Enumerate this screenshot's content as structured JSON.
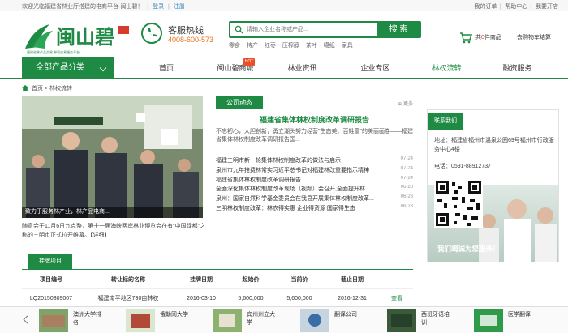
{
  "topbar": {
    "welcome": "欢迎光临福建省林业厅搭建的电商平台-闽山碧！",
    "login": "登录",
    "register": "注册",
    "links": [
      "我的订单",
      "帮助中心",
      "我要开店"
    ]
  },
  "header": {
    "logo_text": "闽山碧",
    "logo_sub": "福建省林产品交易 林权交易服务平台",
    "hotline_label": "客服热线",
    "hotline_number": "4008-600-573",
    "search_placeholder": "请输入企业名称或产品...",
    "search_button": "搜 索",
    "hotwords": [
      "零食",
      "特产",
      "红枣",
      "压榨醇",
      "茶叶",
      "噶纸",
      "家具"
    ],
    "cart_prefix": "共",
    "cart_count": "0",
    "cart_suffix": "件商品",
    "order_link": "去购物车结算"
  },
  "nav": {
    "category": "全部产品分类",
    "items": [
      "首页",
      "闽山碧商城",
      "林业资讯",
      "企业专区",
      "林权流转",
      "融资服务"
    ],
    "hot_badge": "HOT"
  },
  "breadcrumb": {
    "home": "首页",
    "current": "林权流转"
  },
  "photo": {
    "caption": "致力于服务林产业，林产品电商..."
  },
  "photo_text": "随意会于11月6日九点整，第十一届海峡两岸林业博览会在有\"中国绿都\"之称的三明市正式拉开帷幕。【详细】",
  "news": {
    "tab": "公司动态",
    "more": "更多",
    "headline": "福建省集体林权制度改革调研报告",
    "summary": "不忘初心，大胆创新，勇立潮头努力经营\"生态美、百姓富\"的美丽画卷——福建省集体林权制度改革调研报告国...",
    "items": [
      {
        "title": "福建三明市新一轮集体林权制度改革的做法与启示",
        "date": "07-24"
      },
      {
        "title": "泉州市九年推费林常实习近平总书记对福建林改重要指示精神",
        "date": "07-24"
      },
      {
        "title": "福建省集体林权制度改革调研报告",
        "date": "07-24"
      },
      {
        "title": "全面深化集体林权制度改革现场（视频）会召开,全面提升林...",
        "date": "06-28"
      },
      {
        "title": "泉州：国家自然科学基金委员会在我县开展集体林权制度改革...",
        "date": "06-28"
      },
      {
        "title": "三明林权制度改革：林农得实惠 企业得资源 国家得生态",
        "date": "06-28"
      }
    ]
  },
  "contact": {
    "title": "联系我们",
    "address": "地址：福建省福州市温泉公园69号福州市行政服务中心4楼",
    "phone": "电话：0591-88912737",
    "slogan": "我们竭诚为您服务！"
  },
  "listing": {
    "tab": "挂牌项目",
    "headers": [
      "项目编号",
      "转让标的名称",
      "挂牌日期",
      "起始价",
      "当前价",
      "截止日期"
    ],
    "rows": [
      [
        "LQ20150309007",
        "福建南平地区730亩林权",
        "2016-03-10",
        "5,600,000",
        "5,600,000",
        "2016-12-31",
        "查看"
      ]
    ]
  },
  "ads": [
    {
      "label": "澳洲大学排名"
    },
    {
      "label": "俄勒冈大学"
    },
    {
      "label": "宾州州立大学"
    },
    {
      "label": "翻译公司"
    },
    {
      "label": "西班牙语培训"
    },
    {
      "label": "医学翻译"
    }
  ],
  "colors": {
    "brand_green": "#1e8a44",
    "hotline_orange": "#e8711c"
  }
}
